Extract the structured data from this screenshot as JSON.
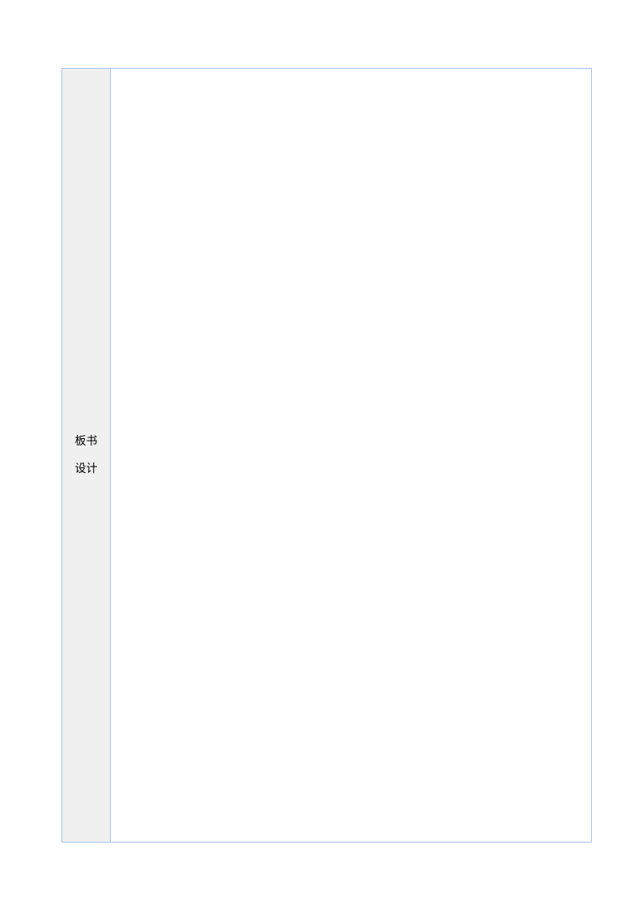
{
  "table": {
    "label_line1": "板书",
    "label_line2": "设计"
  }
}
